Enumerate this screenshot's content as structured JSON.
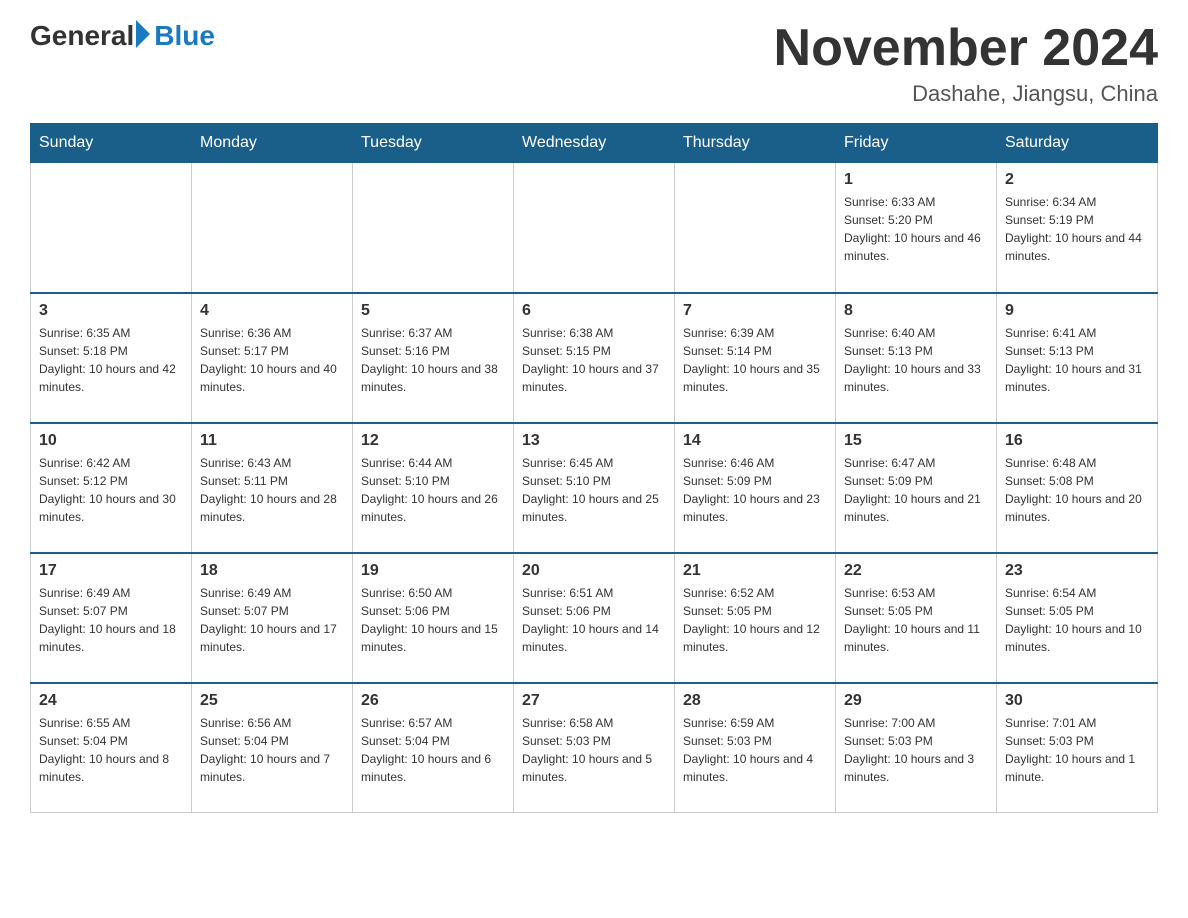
{
  "header": {
    "logo_general": "General",
    "logo_blue": "Blue",
    "month_title": "November 2024",
    "location": "Dashahe, Jiangsu, China"
  },
  "weekdays": [
    "Sunday",
    "Monday",
    "Tuesday",
    "Wednesday",
    "Thursday",
    "Friday",
    "Saturday"
  ],
  "weeks": [
    [
      {
        "day": "",
        "info": ""
      },
      {
        "day": "",
        "info": ""
      },
      {
        "day": "",
        "info": ""
      },
      {
        "day": "",
        "info": ""
      },
      {
        "day": "",
        "info": ""
      },
      {
        "day": "1",
        "info": "Sunrise: 6:33 AM\nSunset: 5:20 PM\nDaylight: 10 hours and 46 minutes."
      },
      {
        "day": "2",
        "info": "Sunrise: 6:34 AM\nSunset: 5:19 PM\nDaylight: 10 hours and 44 minutes."
      }
    ],
    [
      {
        "day": "3",
        "info": "Sunrise: 6:35 AM\nSunset: 5:18 PM\nDaylight: 10 hours and 42 minutes."
      },
      {
        "day": "4",
        "info": "Sunrise: 6:36 AM\nSunset: 5:17 PM\nDaylight: 10 hours and 40 minutes."
      },
      {
        "day": "5",
        "info": "Sunrise: 6:37 AM\nSunset: 5:16 PM\nDaylight: 10 hours and 38 minutes."
      },
      {
        "day": "6",
        "info": "Sunrise: 6:38 AM\nSunset: 5:15 PM\nDaylight: 10 hours and 37 minutes."
      },
      {
        "day": "7",
        "info": "Sunrise: 6:39 AM\nSunset: 5:14 PM\nDaylight: 10 hours and 35 minutes."
      },
      {
        "day": "8",
        "info": "Sunrise: 6:40 AM\nSunset: 5:13 PM\nDaylight: 10 hours and 33 minutes."
      },
      {
        "day": "9",
        "info": "Sunrise: 6:41 AM\nSunset: 5:13 PM\nDaylight: 10 hours and 31 minutes."
      }
    ],
    [
      {
        "day": "10",
        "info": "Sunrise: 6:42 AM\nSunset: 5:12 PM\nDaylight: 10 hours and 30 minutes."
      },
      {
        "day": "11",
        "info": "Sunrise: 6:43 AM\nSunset: 5:11 PM\nDaylight: 10 hours and 28 minutes."
      },
      {
        "day": "12",
        "info": "Sunrise: 6:44 AM\nSunset: 5:10 PM\nDaylight: 10 hours and 26 minutes."
      },
      {
        "day": "13",
        "info": "Sunrise: 6:45 AM\nSunset: 5:10 PM\nDaylight: 10 hours and 25 minutes."
      },
      {
        "day": "14",
        "info": "Sunrise: 6:46 AM\nSunset: 5:09 PM\nDaylight: 10 hours and 23 minutes."
      },
      {
        "day": "15",
        "info": "Sunrise: 6:47 AM\nSunset: 5:09 PM\nDaylight: 10 hours and 21 minutes."
      },
      {
        "day": "16",
        "info": "Sunrise: 6:48 AM\nSunset: 5:08 PM\nDaylight: 10 hours and 20 minutes."
      }
    ],
    [
      {
        "day": "17",
        "info": "Sunrise: 6:49 AM\nSunset: 5:07 PM\nDaylight: 10 hours and 18 minutes."
      },
      {
        "day": "18",
        "info": "Sunrise: 6:49 AM\nSunset: 5:07 PM\nDaylight: 10 hours and 17 minutes."
      },
      {
        "day": "19",
        "info": "Sunrise: 6:50 AM\nSunset: 5:06 PM\nDaylight: 10 hours and 15 minutes."
      },
      {
        "day": "20",
        "info": "Sunrise: 6:51 AM\nSunset: 5:06 PM\nDaylight: 10 hours and 14 minutes."
      },
      {
        "day": "21",
        "info": "Sunrise: 6:52 AM\nSunset: 5:05 PM\nDaylight: 10 hours and 12 minutes."
      },
      {
        "day": "22",
        "info": "Sunrise: 6:53 AM\nSunset: 5:05 PM\nDaylight: 10 hours and 11 minutes."
      },
      {
        "day": "23",
        "info": "Sunrise: 6:54 AM\nSunset: 5:05 PM\nDaylight: 10 hours and 10 minutes."
      }
    ],
    [
      {
        "day": "24",
        "info": "Sunrise: 6:55 AM\nSunset: 5:04 PM\nDaylight: 10 hours and 8 minutes."
      },
      {
        "day": "25",
        "info": "Sunrise: 6:56 AM\nSunset: 5:04 PM\nDaylight: 10 hours and 7 minutes."
      },
      {
        "day": "26",
        "info": "Sunrise: 6:57 AM\nSunset: 5:04 PM\nDaylight: 10 hours and 6 minutes."
      },
      {
        "day": "27",
        "info": "Sunrise: 6:58 AM\nSunset: 5:03 PM\nDaylight: 10 hours and 5 minutes."
      },
      {
        "day": "28",
        "info": "Sunrise: 6:59 AM\nSunset: 5:03 PM\nDaylight: 10 hours and 4 minutes."
      },
      {
        "day": "29",
        "info": "Sunrise: 7:00 AM\nSunset: 5:03 PM\nDaylight: 10 hours and 3 minutes."
      },
      {
        "day": "30",
        "info": "Sunrise: 7:01 AM\nSunset: 5:03 PM\nDaylight: 10 hours and 1 minute."
      }
    ]
  ]
}
